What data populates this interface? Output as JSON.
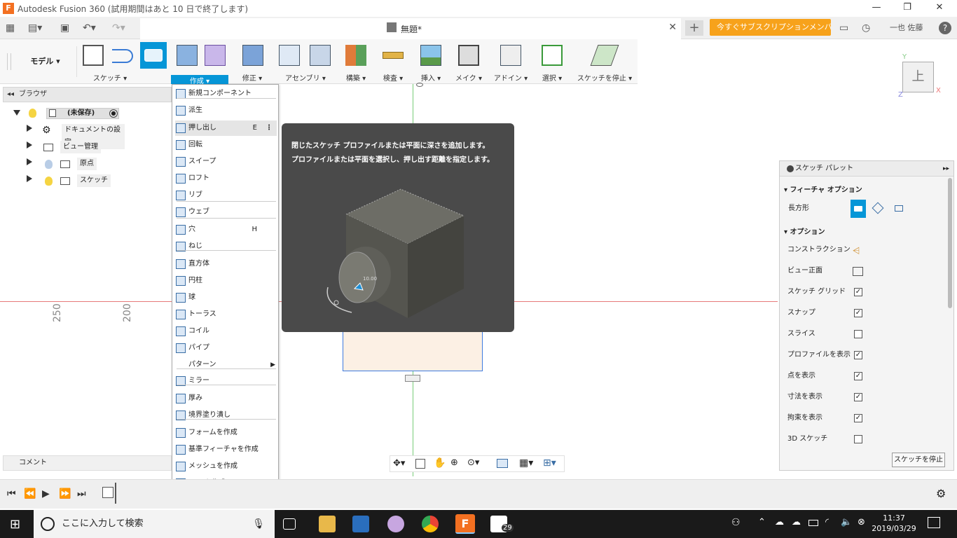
{
  "titlebar": {
    "app_title": "Autodesk Fusion 360 (試用期間はあと 10 日で終了します)"
  },
  "tabs": {
    "doc_name": "無題*",
    "subscribe_label": "今すぐサブスクリプションメンバーに...",
    "user_name": "一也 佐藤"
  },
  "ribbon": {
    "workspace": "モデル ▾",
    "groups": [
      "スケッチ ▾",
      "作成 ▾",
      "修正 ▾",
      "アセンブリ ▾",
      "構築 ▾",
      "検査 ▾",
      "挿入 ▾",
      "メイク ▾",
      "アドイン ▾",
      "選択 ▾",
      "スケッチを停止 ▾"
    ]
  },
  "browser": {
    "header": "ブラウザ",
    "root": "(未保存)",
    "items": [
      "ドキュメントの設定",
      "ビュー管理",
      "原点",
      "スケッチ"
    ]
  },
  "menu": {
    "items": [
      {
        "label": "新規コンポーネント",
        "shortcut": ""
      },
      {
        "label": "派生",
        "shortcut": ""
      },
      {
        "label": "押し出し",
        "shortcut": "E"
      },
      {
        "label": "回転",
        "shortcut": ""
      },
      {
        "label": "スイープ",
        "shortcut": ""
      },
      {
        "label": "ロフト",
        "shortcut": ""
      },
      {
        "label": "リブ",
        "shortcut": ""
      },
      {
        "label": "ウェブ",
        "shortcut": ""
      },
      {
        "label": "穴",
        "shortcut": "H"
      },
      {
        "label": "ねじ",
        "shortcut": ""
      },
      {
        "label": "直方体",
        "shortcut": ""
      },
      {
        "label": "円柱",
        "shortcut": ""
      },
      {
        "label": "球",
        "shortcut": ""
      },
      {
        "label": "トーラス",
        "shortcut": ""
      },
      {
        "label": "コイル",
        "shortcut": ""
      },
      {
        "label": "パイプ",
        "shortcut": ""
      },
      {
        "label": "パターン",
        "shortcut": ""
      },
      {
        "label": "ミラー",
        "shortcut": ""
      },
      {
        "label": "厚み",
        "shortcut": ""
      },
      {
        "label": "境界塗り潰し",
        "shortcut": ""
      },
      {
        "label": "フォームを作成",
        "shortcut": ""
      },
      {
        "label": "基準フィーチャを作成",
        "shortcut": ""
      },
      {
        "label": "メッシュを作成",
        "shortcut": ""
      },
      {
        "label": "PCB を作成",
        "shortcut": ""
      }
    ]
  },
  "tooltip": {
    "line1": "閉じたスケッチ プロファイルまたは平面に深さを追加します。",
    "line2": "プロファイルまたは平面を選択し、押し出す距離を指定します。",
    "dim": "10.00"
  },
  "canvas": {
    "ruler_250": "250",
    "ruler_200": "200",
    "viewcube": "上",
    "axis_y": "Y",
    "axis_x": "X",
    "axis_z": "Z"
  },
  "palette": {
    "title": "スケッチ パレット",
    "sec_feature": "フィーチャ オプション",
    "rect_label": "長方形",
    "sec_options": "オプション",
    "rows": [
      {
        "label": "コンストラクション",
        "checked": null
      },
      {
        "label": "ビュー正面",
        "checked": null
      },
      {
        "label": "スケッチ グリッド",
        "checked": true
      },
      {
        "label": "スナップ",
        "checked": true
      },
      {
        "label": "スライス",
        "checked": false
      },
      {
        "label": "プロファイルを表示",
        "checked": true
      },
      {
        "label": "点を表示",
        "checked": true
      },
      {
        "label": "寸法を表示",
        "checked": true
      },
      {
        "label": "拘束を表示",
        "checked": true
      },
      {
        "label": "3D スケッチ",
        "checked": false
      }
    ],
    "stop_button": "スケッチを停止"
  },
  "comment": {
    "label": "コメント"
  },
  "taskbar": {
    "search_placeholder": "ここに入力して検索",
    "time": "11:37",
    "date": "2019/03/29",
    "badge": "29"
  },
  "colors": {
    "accent": "#0696d7",
    "subscribe": "#f7a21b",
    "tooltip_bg": "#4a4a4a"
  }
}
